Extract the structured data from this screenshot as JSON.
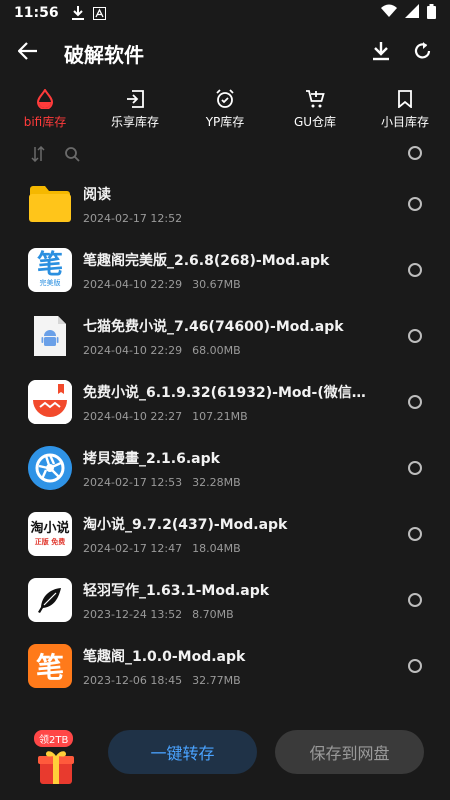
{
  "status": {
    "time": "11:56"
  },
  "header": {
    "title": "破解软件"
  },
  "tabs": [
    {
      "label": "bifi库存",
      "icon": "drop-icon",
      "active": true
    },
    {
      "label": "乐享库存",
      "icon": "import-icon"
    },
    {
      "label": "YP库存",
      "icon": "alarm-clock-icon"
    },
    {
      "label": "GU仓库",
      "icon": "cart-icon"
    },
    {
      "label": "小目库存",
      "icon": "bookmark-icon"
    }
  ],
  "files": [
    {
      "name": "阅读",
      "date": "2024-02-17 12:52",
      "size": "",
      "thumb": "folder"
    },
    {
      "name": "笔趣阁完美版_2.6.8(268)-Mod.apk",
      "date": "2024-04-10 22:29",
      "size": "30.67MB",
      "thumb": "biqu-perfect",
      "thumb_text": "笔",
      "thumb_sub": "完美版"
    },
    {
      "name": "七猫免费小说_7.46(74600)-Mod.apk",
      "date": "2024-04-10 22:29",
      "size": "68.00MB",
      "thumb": "android"
    },
    {
      "name": "免费小说_6.1.9.32(61932)-Mod-(微信公众号...",
      "date": "2024-04-10 22:27",
      "size": "107.21MB",
      "thumb": "tomato"
    },
    {
      "name": "拷貝漫畫_2.1.6.apk",
      "date": "2024-02-17 12:53",
      "size": "32.28MB",
      "thumb": "aperture"
    },
    {
      "name": "淘小说_9.7.2(437)-Mod.apk",
      "date": "2024-02-17 12:47",
      "size": "18.04MB",
      "thumb": "taoxiaoshuo",
      "thumb_text": "淘小说",
      "thumb_sub": "正版 免费"
    },
    {
      "name": "轻羽写作_1.63.1-Mod.apk",
      "date": "2023-12-24 13:52",
      "size": "8.70MB",
      "thumb": "feather"
    },
    {
      "name": "笔趣阁_1.0.0-Mod.apk",
      "date": "2023-12-06 18:45",
      "size": "32.77MB",
      "thumb": "biqu",
      "thumb_text": "笔"
    }
  ],
  "bottom": {
    "gift_badge": "领2TB",
    "primary_label": "一键转存",
    "secondary_label": "保存到网盘"
  },
  "colors": {
    "accent": "#ff3b3b",
    "primary_text": "#4aa3ff"
  }
}
